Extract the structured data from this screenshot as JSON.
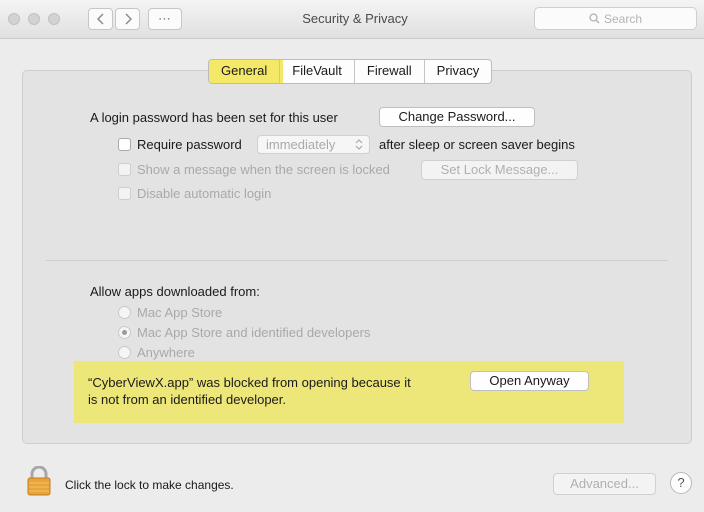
{
  "window": {
    "title": "Security & Privacy",
    "search_placeholder": "Search",
    "grid_glyph": "⋯"
  },
  "tabs": [
    {
      "label": "General",
      "active": true
    },
    {
      "label": "FileVault",
      "active": false
    },
    {
      "label": "Firewall",
      "active": false
    },
    {
      "label": "Privacy",
      "active": false
    }
  ],
  "general": {
    "login_text": "A login password has been set for this user",
    "change_password_label": "Change Password...",
    "require_password_label": "Require password",
    "require_password_checked": false,
    "require_select_value": "immediately",
    "require_suffix": "after sleep or screen saver begins",
    "show_message_label": "Show a message when the screen is locked",
    "show_message_checked": false,
    "set_lock_message_label": "Set Lock Message...",
    "disable_login_label": "Disable automatic login",
    "disable_login_checked": false
  },
  "downloads": {
    "heading": "Allow apps downloaded from:",
    "options": [
      {
        "label": "Mac App Store",
        "selected": false
      },
      {
        "label": "Mac App Store and identified developers",
        "selected": true
      },
      {
        "label": "Anywhere",
        "selected": false
      }
    ],
    "blocked_line1": "“CyberViewX.app” was blocked from opening because it",
    "blocked_line2": "is not from an identified developer.",
    "open_anyway_label": "Open Anyway"
  },
  "footer": {
    "lock_text": "Click the lock to make changes.",
    "advanced_label": "Advanced...",
    "help_label": "?"
  },
  "colors": {
    "highlight": "#ede77a",
    "lock": "#e8a33a"
  },
  "icons": [
    "lock-icon",
    "search-icon",
    "chevron-left-icon",
    "chevron-right-icon",
    "grid-icon",
    "updown-arrows-icon",
    "help-icon"
  ]
}
